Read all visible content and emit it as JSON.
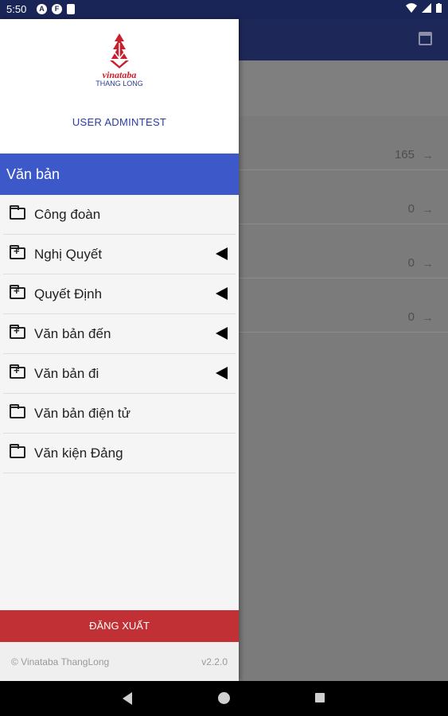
{
  "status_bar": {
    "time": "5:50",
    "notif_icons": [
      "A",
      "F",
      "▮"
    ]
  },
  "background": {
    "rows": [
      {
        "value": "165",
        "arrow": "→"
      },
      {
        "value": "0",
        "arrow": "→"
      },
      {
        "value": "0",
        "arrow": "→"
      },
      {
        "value": "0",
        "arrow": "→"
      }
    ]
  },
  "drawer": {
    "logo": {
      "brand": "vinataba",
      "sub": "THANG LONG"
    },
    "user": "USER ADMINTEST",
    "section_title": "Văn bản",
    "items": [
      {
        "label": "Công đoàn",
        "icon": "folder-icon",
        "expandable": false
      },
      {
        "label": "Nghị Quyết",
        "icon": "folder-plus-icon",
        "expandable": true
      },
      {
        "label": "Quyết Định",
        "icon": "folder-plus-icon",
        "expandable": true
      },
      {
        "label": "Văn bản đến",
        "icon": "folder-plus-icon",
        "expandable": true
      },
      {
        "label": "Văn bản đi",
        "icon": "folder-plus-icon",
        "expandable": true
      },
      {
        "label": "Văn bản điện tử",
        "icon": "folder-icon",
        "expandable": false
      },
      {
        "label": "Văn kiện Đảng",
        "icon": "folder-icon",
        "expandable": false
      }
    ],
    "logout_label": "ĐĂNG XUẤT",
    "copyright": "© Vinataba ThangLong",
    "version": "v2.2.0"
  },
  "colors": {
    "primary": "#3c58c9",
    "appbar": "#1e2858",
    "logout": "#c13034",
    "brand_red": "#c8202d"
  }
}
